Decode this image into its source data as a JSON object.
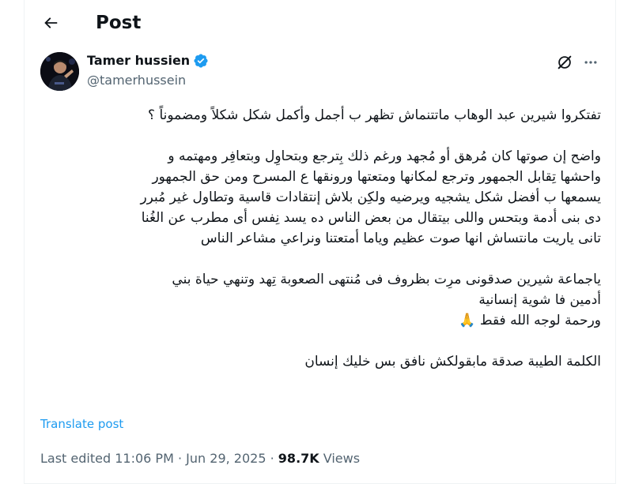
{
  "header": {
    "title": "Post"
  },
  "author": {
    "name": "Tamer hussien",
    "handle": "@tamerhussein"
  },
  "post": {
    "paragraphs": [
      [
        "تفتكروا شيرين عبد الوهاب ماتتنماش تظهر ب أجمل وأكمل شكل   شكلاً ومضموناً ؟"
      ],
      [
        "واضح إن صوتها كان مُرهق أو مُجهد ورغم ذلك بِترجع وبتحاوِل وبتعافِر ومهتمه و",
        "واحشها تِقابل الجمهور وترجع لمكانها ومتعتها ورونقها ع المسرح ومن حق الجمهور",
        "يسمعها ب أفضل شكل يشجيه ويرضيه ولكِن بلاش إنتقادات قاسية وتطاول غير مُبرر",
        "دى بنى أدمة وبتحس واللى بيتقال من بعض الناس ده  يسد نِفس أى مطرب عن الغُنا",
        "تانى  ياريت مانتساش انها صوت عظيم وياما أمتعتنا ونراعي مشاعر الناس"
      ],
      [
        "ياجماعة شيرين صدقونى مرِت بظروف فى مُنتهى الصعوبة تِهد وتنهي حياة بني",
        "أدمين فا شوية إنسانية",
        "ورحمة لوجه الله فقط 🙏"
      ],
      [
        "الكلمة الطيبة صدقة مابقولكش نافق بس خليك إنسان"
      ]
    ],
    "translate_label": "Translate post",
    "edited_label": "Last edited",
    "time": "11:06 PM",
    "separator": "·",
    "date": "Jun 29, 2025",
    "views_count": "98.7K",
    "views_label": "Views"
  },
  "icons": {
    "back": "arrow-left-icon",
    "verified": "verified-badge-icon",
    "grok": "grok-icon",
    "more": "more-horizontal-icon"
  },
  "colors": {
    "accent": "#1d9bf0",
    "secondary_text": "#536471",
    "primary_text": "#0f1419"
  }
}
